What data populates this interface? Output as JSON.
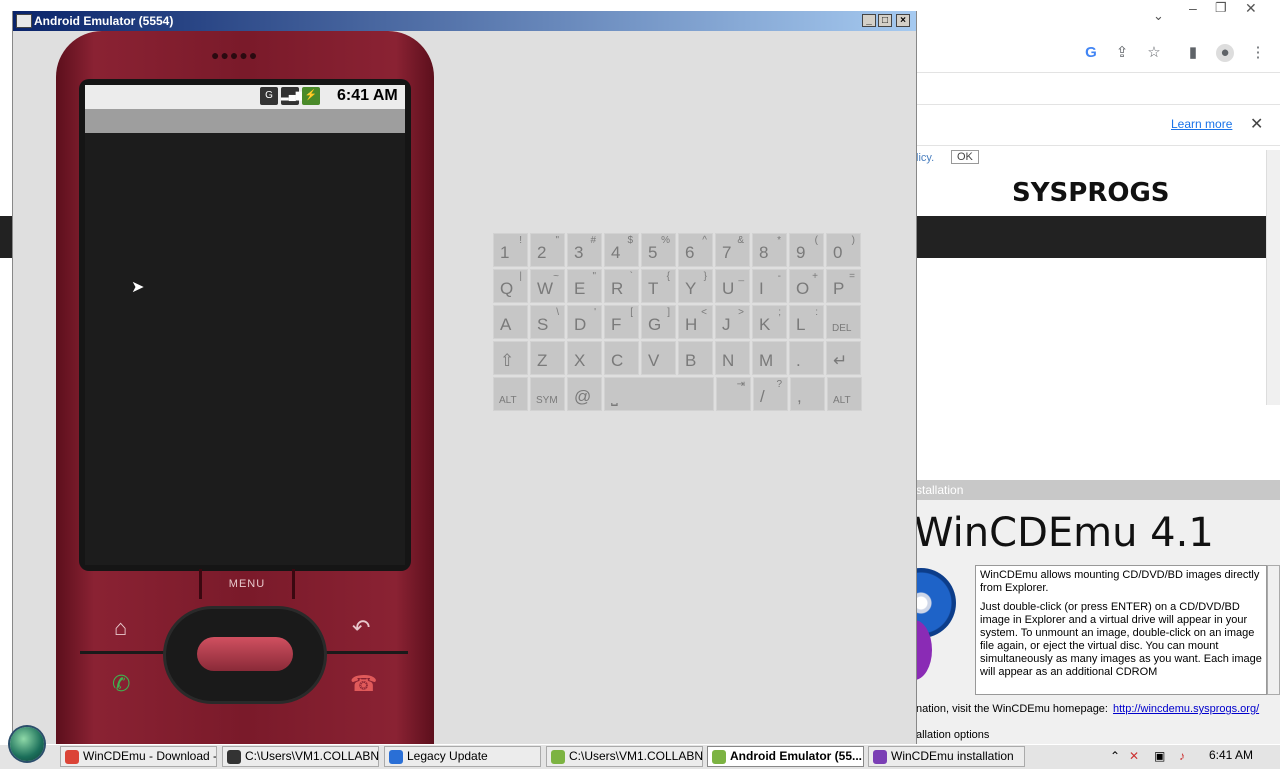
{
  "chrome": {
    "learn_more": "Learn more",
    "close": "✕",
    "policy_text": "licy.",
    "ok_button": "OK",
    "logo_text": "SYSPROGS"
  },
  "installer": {
    "title": "stallation",
    "heading": "WinCDEmu 4.1",
    "paragraphs": [
      "WinCDEmu allows mounting CD/DVD/BD images directly from Explorer.",
      "Just double-click (or press ENTER) on a CD/DVD/BD image in Explorer and a virtual drive will appear in your system. To unmount an image, double-click on an image file again, or eject the virtual disc. You can mount simultaneously as many images as you want. Each image will appear as an additional CDROM"
    ],
    "homepage_text": "nation, visit the WinCDEmu homepage:",
    "homepage_link": "http://wincdemu.sysprogs.org/",
    "options_text": "allation options"
  },
  "emulator": {
    "title": "Android Emulator (5554)",
    "buttons": {
      "minimize": "_",
      "maximize": "□",
      "close": "×"
    },
    "status_time": "6:41 AM",
    "status_icons": [
      "G",
      "signal",
      "battery"
    ],
    "menu_label": "MENU",
    "keyboard": {
      "rows": [
        [
          {
            "m": "1",
            "s": "!"
          },
          {
            "m": "2",
            "s": "\""
          },
          {
            "m": "3",
            "s": "#"
          },
          {
            "m": "4",
            "s": "$"
          },
          {
            "m": "5",
            "s": "%"
          },
          {
            "m": "6",
            "s": "^"
          },
          {
            "m": "7",
            "s": "&"
          },
          {
            "m": "8",
            "s": "*"
          },
          {
            "m": "9",
            "s": "("
          },
          {
            "m": "0",
            "s": ")"
          }
        ],
        [
          {
            "m": "Q",
            "s": "|"
          },
          {
            "m": "W",
            "s": "~"
          },
          {
            "m": "E",
            "s": "\""
          },
          {
            "m": "R",
            "s": "`"
          },
          {
            "m": "T",
            "s": "{"
          },
          {
            "m": "Y",
            "s": "}"
          },
          {
            "m": "U",
            "s": "_"
          },
          {
            "m": "I",
            "s": "-"
          },
          {
            "m": "O",
            "s": "+"
          },
          {
            "m": "P",
            "s": "="
          }
        ],
        [
          {
            "m": "A",
            "s": ""
          },
          {
            "m": "S",
            "s": "\\"
          },
          {
            "m": "D",
            "s": "'"
          },
          {
            "m": "F",
            "s": "["
          },
          {
            "m": "G",
            "s": "]"
          },
          {
            "m": "H",
            "s": "<"
          },
          {
            "m": "J",
            "s": ">"
          },
          {
            "m": "K",
            "s": ";"
          },
          {
            "m": "L",
            "s": ":"
          },
          {
            "m": "DEL",
            "s": ""
          }
        ],
        [
          {
            "m": "⇧",
            "s": ""
          },
          {
            "m": "Z",
            "s": ""
          },
          {
            "m": "X",
            "s": ""
          },
          {
            "m": "C",
            "s": ""
          },
          {
            "m": "V",
            "s": ""
          },
          {
            "m": "B",
            "s": ""
          },
          {
            "m": "N",
            "s": ""
          },
          {
            "m": "M",
            "s": ""
          },
          {
            "m": ".",
            "s": ""
          },
          {
            "m": "↵",
            "s": ""
          }
        ],
        [
          {
            "m": "ALT",
            "s": ""
          },
          {
            "m": "SYM",
            "s": ""
          },
          {
            "m": "@",
            "s": ""
          },
          {
            "m": "⎵",
            "s": ""
          },
          {
            "m": "",
            "s": "⇥"
          },
          {
            "m": "/",
            "s": "?"
          },
          {
            "m": ",",
            "s": ""
          },
          {
            "m": "ALT",
            "s": ""
          }
        ]
      ]
    }
  },
  "taskbar": {
    "tasks": [
      {
        "label": "WinCDEmu - Download - ...",
        "color": "#db4437"
      },
      {
        "label": "C:\\Users\\VM1.COLLABN...",
        "color": "#333333"
      },
      {
        "label": "Legacy Update",
        "color": "#2a6fd6"
      },
      {
        "label": "C:\\Users\\VM1.COLLABN...",
        "color": "#7cb342"
      },
      {
        "label": "Android Emulator (55...",
        "color": "#7cb342"
      },
      {
        "label": "WinCDEmu installation",
        "color": "#7b3fb5"
      }
    ],
    "tray_icons": [
      "chevron-up",
      "network-x",
      "monitor",
      "speaker-x"
    ],
    "time": "6:41 AM"
  }
}
